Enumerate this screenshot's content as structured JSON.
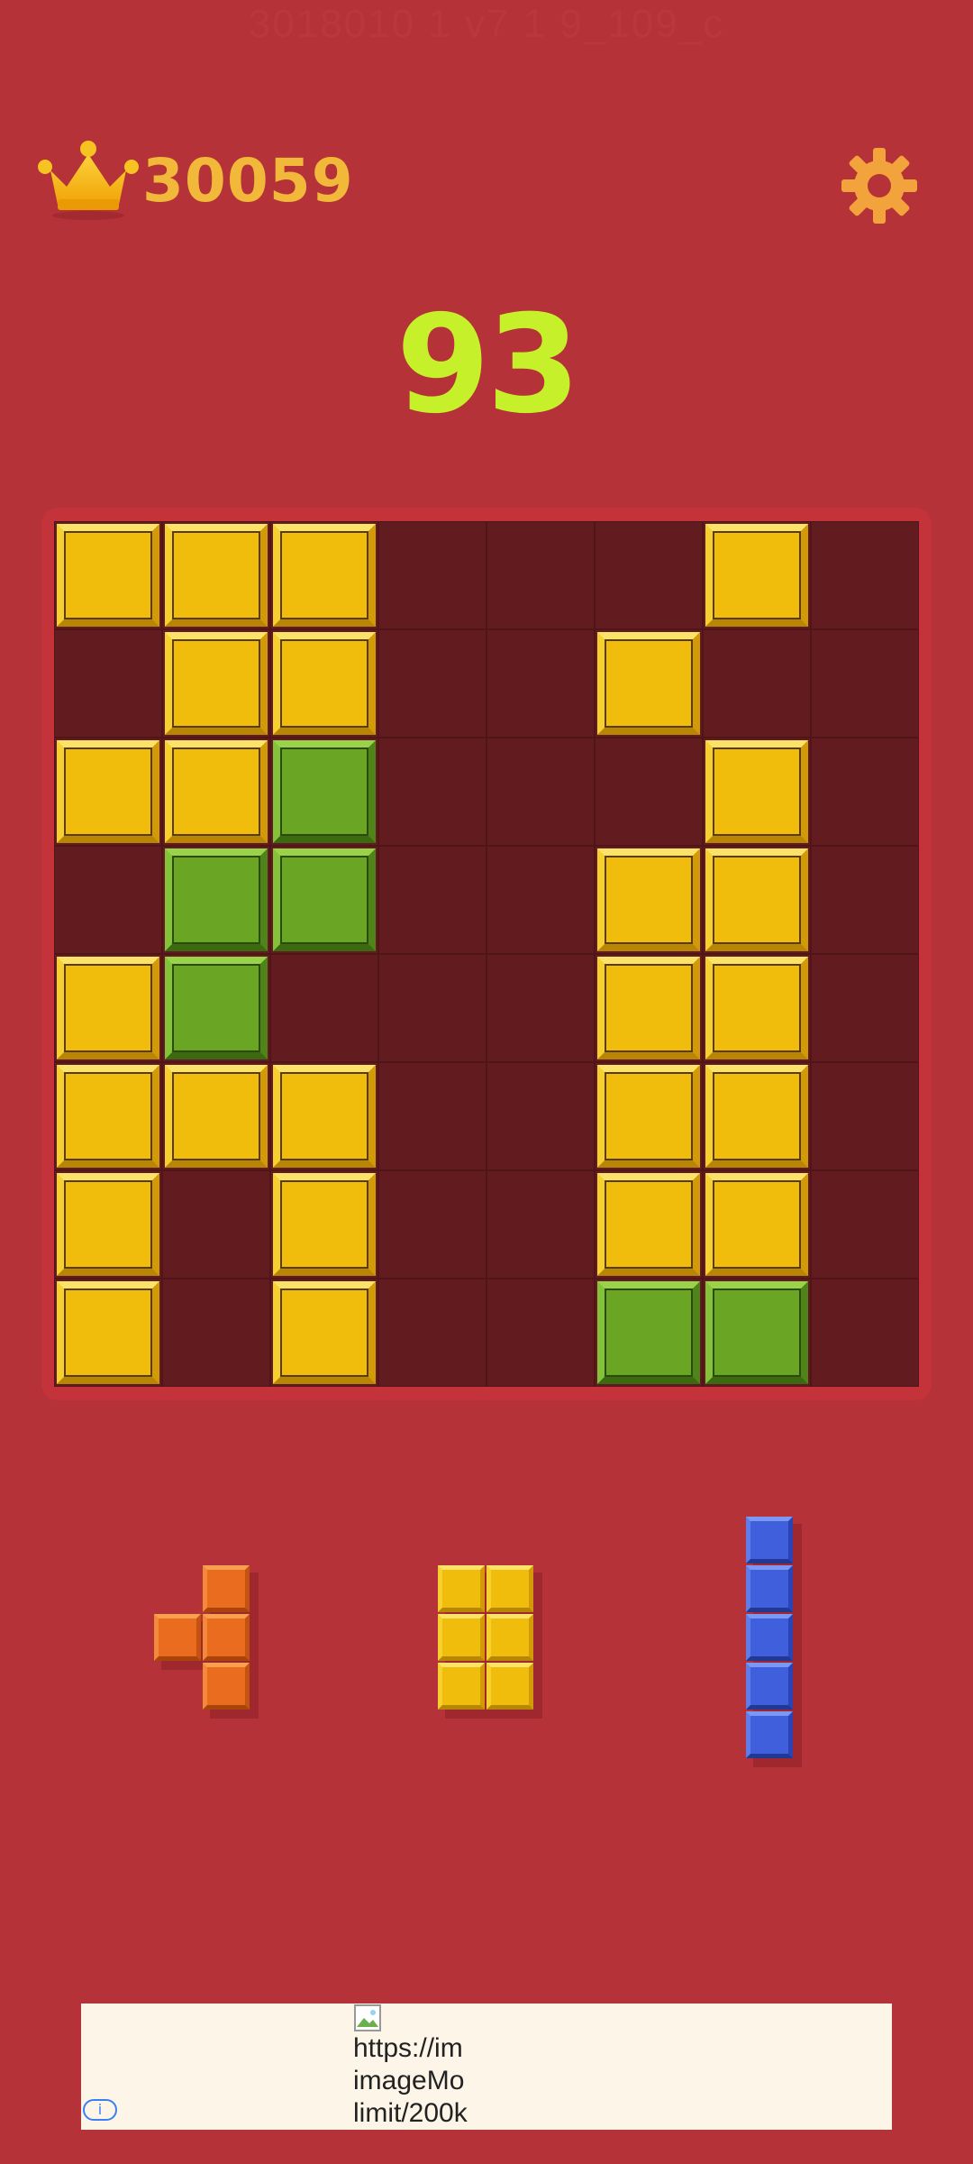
{
  "watermark": "3018010 1 v7 1 9_109_c",
  "header": {
    "best_score": "30059",
    "crown_icon": "crown-icon",
    "settings_icon": "gear-icon",
    "accent": "#f2b83a"
  },
  "score": "93",
  "board": {
    "rows": 8,
    "cols": 8,
    "cells": [
      [
        "Y",
        "Y",
        "Y",
        ".",
        ".",
        ".",
        "Y",
        "."
      ],
      [
        ".",
        "Y",
        "Y",
        ".",
        ".",
        "Y",
        ".",
        "."
      ],
      [
        "Y",
        "Y",
        "G",
        ".",
        ".",
        ".",
        "Y",
        "."
      ],
      [
        ".",
        "G",
        "G",
        ".",
        ".",
        "Y",
        "Y",
        "."
      ],
      [
        "Y",
        "G",
        ".",
        ".",
        ".",
        "Y",
        "Y",
        "."
      ],
      [
        "Y",
        "Y",
        "Y",
        ".",
        ".",
        "Y",
        "Y",
        "."
      ],
      [
        "Y",
        ".",
        "Y",
        ".",
        ".",
        "Y",
        "Y",
        "."
      ],
      [
        "Y",
        ".",
        "Y",
        ".",
        ".",
        "G",
        "G",
        "."
      ]
    ],
    "colors": {
      "Y": "#f0bd0c",
      "G": "#6aa524",
      "empty": "#621c20"
    }
  },
  "pieces": [
    {
      "name": "orange-t-piece",
      "color": "orange",
      "cells": [
        [
          0,
          1
        ],
        [
          1,
          0
        ],
        [
          1,
          1
        ],
        [
          2,
          1
        ]
      ]
    },
    {
      "name": "yellow-rect-piece",
      "color": "yellow",
      "cells": [
        [
          0,
          0
        ],
        [
          0,
          1
        ],
        [
          1,
          0
        ],
        [
          1,
          1
        ],
        [
          2,
          0
        ],
        [
          2,
          1
        ]
      ]
    },
    {
      "name": "blue-line-piece",
      "color": "blue",
      "cells": [
        [
          0,
          0
        ],
        [
          1,
          0
        ],
        [
          2,
          0
        ],
        [
          3,
          0
        ],
        [
          4,
          0
        ]
      ]
    }
  ],
  "ad": {
    "image_alt": "https://imageMogr2/limit/200k",
    "alt_lines": [
      "https://im",
      "imageMo",
      "limit/200k"
    ],
    "info_icon": "info-icon",
    "info_label": "i"
  }
}
